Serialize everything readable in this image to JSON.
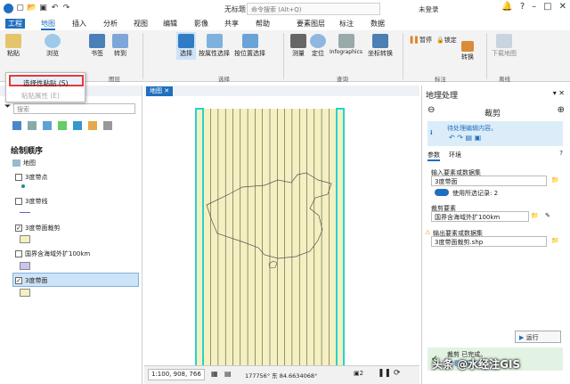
{
  "window": {
    "title": "无标题",
    "search_placeholder": "命令搜索 (Alt+Q)",
    "signin": "未登录"
  },
  "tabs": [
    "工程",
    "地图",
    "插入",
    "分析",
    "视图",
    "编辑",
    "影像",
    "共享",
    "帮助",
    "要素图层",
    "标注",
    "数据"
  ],
  "ribbon": {
    "buttons": [
      "粘贴",
      "浏览",
      "书签",
      "转到",
      "选择",
      "按属性选择",
      "按位置选择",
      "测量",
      "定位",
      "Infographics",
      "坐标转换",
      "暂停",
      "锁定",
      "转换",
      "下载地图"
    ],
    "groups": [
      "图层",
      "选择",
      "查询",
      "标注",
      "离线"
    ],
    "label_small": [
      "暂停",
      "锁定"
    ]
  },
  "paste_menu": {
    "item1": "选择性粘贴 (S)",
    "item2": "粘贴属性 (E)"
  },
  "contents": {
    "search_placeholder": "搜索",
    "heading": "绘制顺序",
    "map_name": "地图",
    "layers": [
      {
        "name": "3度带点",
        "checked": false
      },
      {
        "name": "3度带线",
        "checked": false
      },
      {
        "name": "3度带面裁剪",
        "checked": true
      },
      {
        "name": "国界含海域外扩100km",
        "checked": false
      },
      {
        "name": "3度带面",
        "checked": true
      }
    ]
  },
  "map_view": {
    "tab": "地图",
    "scale": "1:100, 908, 766",
    "coords": "177756° 东 84.6634068°",
    "selected": "2"
  },
  "geoprocessing": {
    "panel_title": "地理处理",
    "tool_title": "裁剪",
    "info": "待处理编辑内容。",
    "tab_params": "参数",
    "tab_env": "环境",
    "input_label": "输入要素或数据集",
    "input_value": "3度带面",
    "use_selected": "使用所选记录: 2",
    "clip_label": "裁剪要素",
    "clip_value": "国界含海域外扩100km",
    "output_label": "输出要素或数据集",
    "output_value": "3度带面裁剪.shp",
    "run": "运行",
    "status": "裁剪 已完成。",
    "status_sub": "查看详细信息"
  },
  "watermark": "头条 @水经注GIS",
  "colors": {
    "accent": "#1f6fbf",
    "band_fill": "#f5f0c0",
    "band_edge": "#22d3d3",
    "highlight": "#e53935"
  }
}
